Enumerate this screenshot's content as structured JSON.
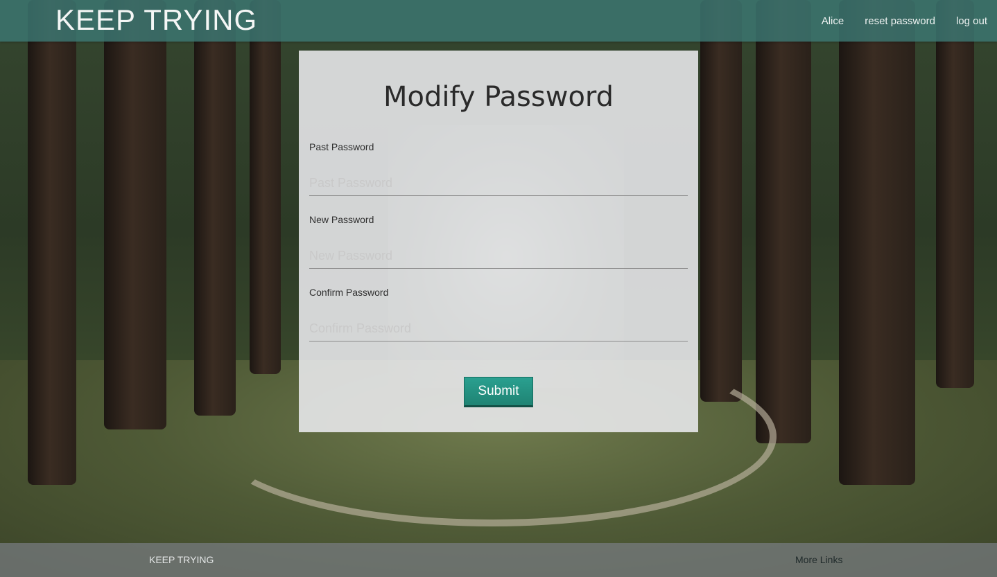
{
  "navbar": {
    "brand": "KEEP TRYING",
    "links": [
      "Alice",
      "reset password",
      "log out"
    ]
  },
  "form": {
    "title": "Modify Password",
    "fields": [
      {
        "label": "Past Password",
        "placeholder": "Past Password",
        "value": ""
      },
      {
        "label": "New Password",
        "placeholder": "New Password",
        "value": ""
      },
      {
        "label": "Confirm Password",
        "placeholder": "Confirm Password",
        "value": ""
      }
    ],
    "submit_label": "Submit"
  },
  "footer": {
    "brand": "KEEP TRYING",
    "links_label": "More Links"
  },
  "colors": {
    "navbar_bg": "#3c7873",
    "button_bg": "#1f8373",
    "card_bg": "#ebebee"
  },
  "icons": {
    "background": "forest-path-photo"
  }
}
